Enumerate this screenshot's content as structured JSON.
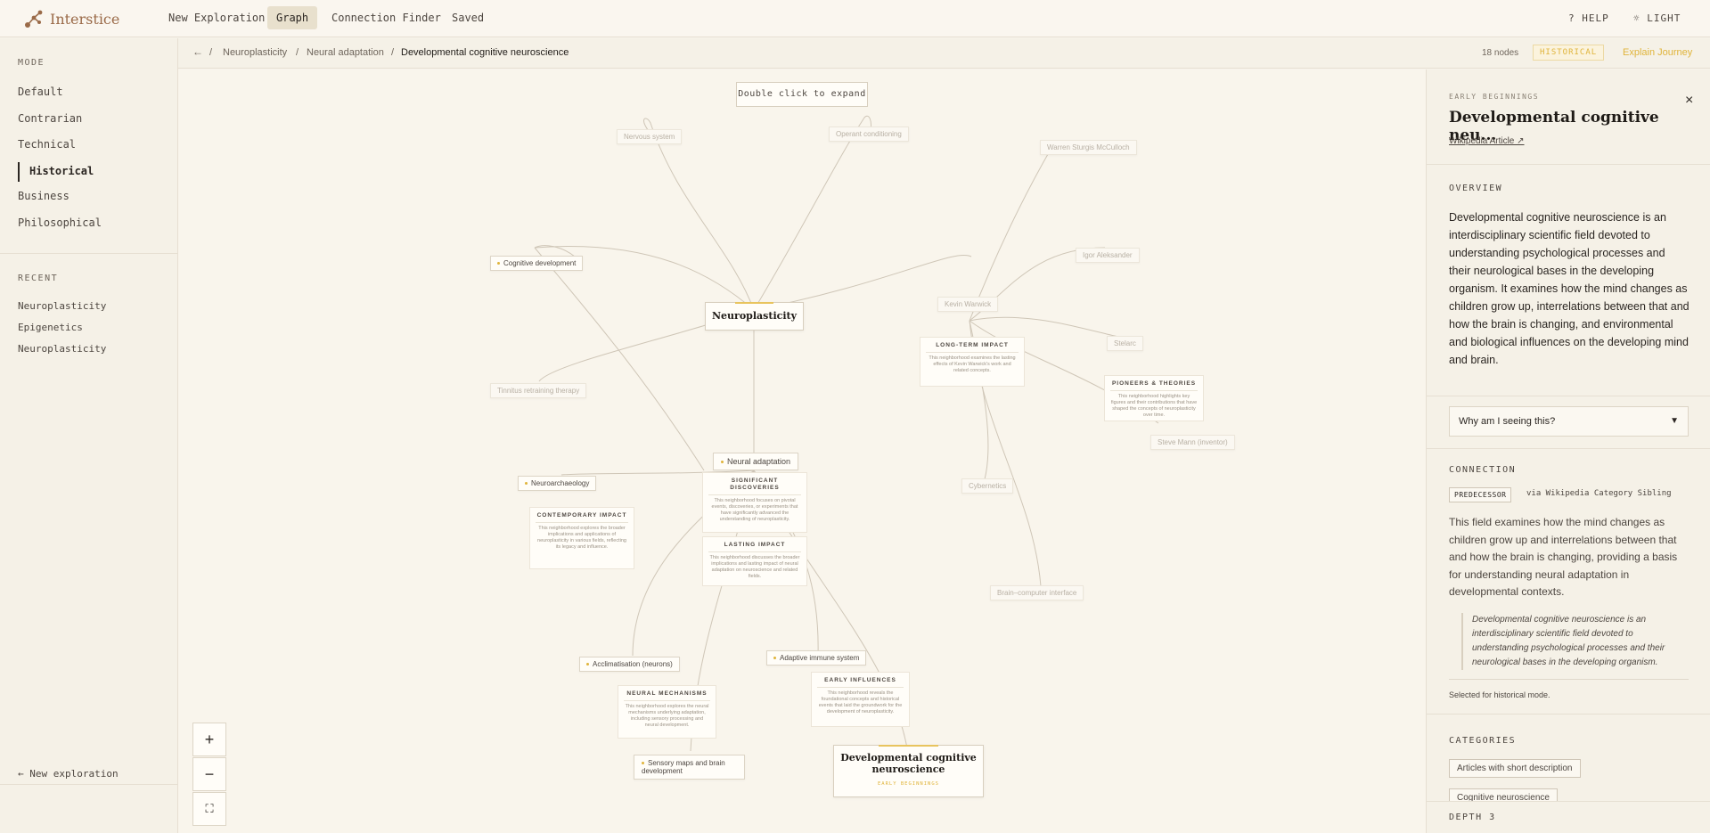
{
  "app": {
    "name": "Interstice"
  },
  "nav": {
    "tabs": [
      "New Exploration",
      "Graph",
      "Connection Finder",
      "Saved"
    ],
    "active": "Graph"
  },
  "topright": {
    "help": "? HELP",
    "theme": "☼ LIGHT"
  },
  "sidebar": {
    "mode_heading": "MODE",
    "modes": [
      "Default",
      "Contrarian",
      "Technical",
      "Historical",
      "Business",
      "Philosophical"
    ],
    "active_mode": "Historical",
    "recent_heading": "RECENT",
    "recent": [
      "Neuroplasticity",
      "Epigenetics",
      "Neuroplasticity"
    ],
    "new_exploration": "← New exploration"
  },
  "breadcrumb": {
    "back": "←",
    "items": [
      "Neuroplasticity",
      "Neural adaptation",
      "Developmental cognitive neuroscience"
    ],
    "node_count": "18 nodes",
    "mode_badge": "HISTORICAL",
    "explain": "Explain Journey"
  },
  "canvas": {
    "hint": "Double click to expand",
    "zoom_in": "+",
    "zoom_out": "−",
    "fit": "⛶"
  },
  "graph": {
    "main": {
      "title": "Neuroplasticity"
    },
    "target": {
      "title": "Developmental cognitive neuroscience",
      "tag": "EARLY BEGINNINGS"
    },
    "nodes": {
      "nervous_system": "Nervous system",
      "operant": "Operant conditioning",
      "warren": "Warren Sturgis McCulloch",
      "igor": "Igor Aleksander",
      "kevin": "Kevin Warwick",
      "stelarc": "Stelarc",
      "steve": "Steve Mann (inventor)",
      "cybernetics": "Cybernetics",
      "bci": "Brain–computer interface",
      "cognitive": "Cognitive development",
      "tinnitus": "Tinnitus retraining therapy",
      "neural_adaptation": "Neural adaptation",
      "neuroarchaeology": "Neuroarchaeology",
      "acclimatisation": "Acclimatisation (neurons)",
      "adaptive_immune": "Adaptive immune system",
      "sensory_maps": "Sensory maps and brain development"
    },
    "clusters": {
      "long_term": {
        "title": "LONG-TERM IMPACT",
        "desc": "This neighborhood examines the lasting effects of Kevin Warwick's work and related concepts."
      },
      "pioneers": {
        "title": "PIONEERS & THEORIES",
        "desc": "This neighborhood highlights key figures and their contributions that have shaped the concepts of neuroplasticity over time."
      },
      "contemporary": {
        "title": "CONTEMPORARY IMPACT",
        "desc": "This neighborhood explores the broader implications and applications of neuroplasticity in various fields, reflecting its legacy and influence."
      },
      "significant": {
        "title": "SIGNIFICANT DISCOVERIES",
        "desc": "This neighborhood focuses on pivotal events, discoveries, or experiments that have significantly advanced the understanding of neuroplasticity."
      },
      "lasting": {
        "title": "LASTING IMPACT",
        "desc": "This neighborhood discusses the broader implications and lasting impact of neural adaptation on neuroscience and related fields."
      },
      "neural_mech": {
        "title": "NEURAL MECHANISMS",
        "desc": "This neighborhood explores the neural mechanisms underlying adaptation, including sensory processing and neural development."
      },
      "early_infl": {
        "title": "EARLY INFLUENCES",
        "desc": "This neighborhood reveals the foundational concepts and historical events that laid the groundwork for the development of neuroplasticity."
      }
    }
  },
  "panel": {
    "eyebrow": "EARLY BEGINNINGS",
    "title": "Developmental cognitive neu...",
    "close": "×",
    "wiki": "Wikipedia Article ↗",
    "overview_label": "OVERVIEW",
    "overview": "Developmental cognitive neuroscience is an interdisciplinary scientific field devoted to understanding psychological processes and their neurological bases in the developing organism. It examines how the mind changes as children grow up, interrelations between that and how the brain is changing, and environmental and biological influences on the developing mind and brain.",
    "why": "Why am I seeing this?",
    "connection_label": "CONNECTION",
    "predecessor": "PREDECESSOR",
    "via": "via Wikipedia Category Sibling",
    "connection_text": "This field examines how the mind changes as children grow up and interrelations between that and how the brain is changing, providing a basis for understanding neural adaptation in developmental contexts.",
    "quote": "Developmental cognitive neuroscience is an interdisciplinary scientific field devoted to understanding psychological processes and their neurological bases in the developing organism.",
    "selected": "Selected for historical mode.",
    "categories_label": "CATEGORIES",
    "categories": [
      "Articles with short description",
      "Cognitive neuroscience"
    ],
    "depth": "DEPTH 3"
  },
  "colors": {
    "accent": "#e0b43a",
    "brand": "#9a6a48",
    "background": "#f7f3eb"
  }
}
